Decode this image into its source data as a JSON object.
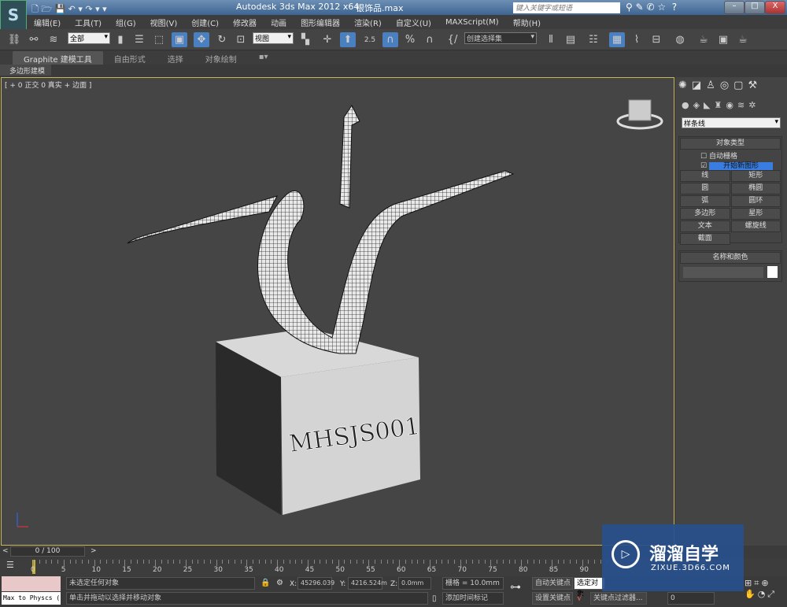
{
  "window": {
    "title": "Autodesk 3ds Max  2012 x64",
    "file": "银饰品.max",
    "search_placeholder": "键入关键字或短语",
    "min": "–",
    "max": "□",
    "close": "X"
  },
  "menu": [
    "编辑(E)",
    "工具(T)",
    "组(G)",
    "视图(V)",
    "创建(C)",
    "修改器",
    "动画",
    "图形编辑器",
    "渲染(R)",
    "自定义(U)",
    "MAXScript(M)",
    "帮助(H)"
  ],
  "toolbar": {
    "selection_filter": "全部",
    "ref_coord": "视图",
    "named_selection": "创建选择集",
    "snap_angle": "2.5"
  },
  "ribbon": {
    "tabs": [
      "Graphite 建模工具",
      "自由形式",
      "选择",
      "对象绘制"
    ],
    "subtab": "多边形建模"
  },
  "viewport": {
    "label": "[ + 0 正交 0 真实 + 边面 ]",
    "model_text": "MHSJS001"
  },
  "command_panel": {
    "category_dropdown": "样条线",
    "object_type_title": "对象类型",
    "auto_grid": "自动栅格",
    "start_new_shape": "开始新图形",
    "buttons": [
      "线",
      "矩形",
      "圆",
      "椭圆",
      "弧",
      "圆环",
      "多边形",
      "星形",
      "文本",
      "螺旋线",
      "截面"
    ],
    "name_color_title": "名称和颜色",
    "name_value": "",
    "color": "#ffffff"
  },
  "timeline": {
    "frame": "0 / 100",
    "ticks": [
      "0",
      "5",
      "10",
      "15",
      "20",
      "25",
      "30",
      "35",
      "40",
      "45",
      "50",
      "55",
      "60",
      "65",
      "70",
      "75",
      "80",
      "85",
      "90"
    ]
  },
  "status": {
    "script_listener": "Max to Physcs (",
    "selection": "未选定任何对象",
    "prompt": "单击并拖动以选择并移动对象",
    "x_label": "X:",
    "x": "45296.039",
    "y_label": "Y:",
    "y": "4216.524m",
    "z_label": "Z:",
    "z": "0.0mm",
    "grid": "栅格 = 10.0mm",
    "add_time_tag": "添加时间标记",
    "auto_key": "自动关键点",
    "selected_dropdown": "选定对象",
    "set_key": "设置关键点",
    "key_filters": "关键点过滤器...",
    "current_frame": "0"
  },
  "watermark": {
    "name": "溜溜自学",
    "url": "ZIXUE.3D66.COM"
  }
}
